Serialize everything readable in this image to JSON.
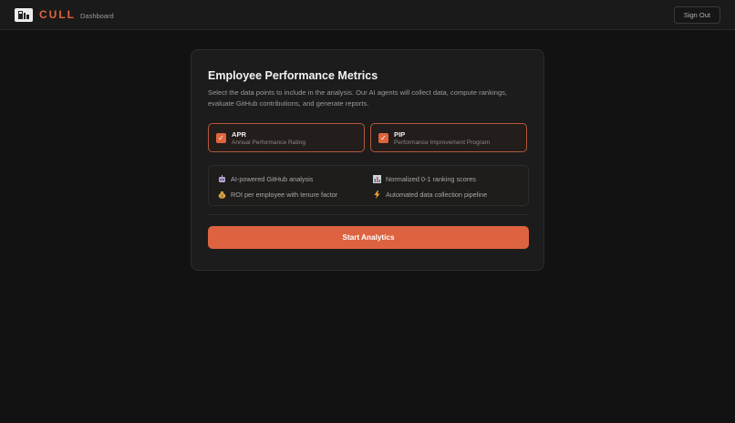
{
  "header": {
    "brand": "CULL",
    "subtitle": "Dashboard",
    "signout_label": "Sign Out"
  },
  "card": {
    "title": "Employee Performance Metrics",
    "description": "Select the data points to include in the analysis. Our AI agents will collect data, compute rankings, evaluate GitHub contributions, and generate reports.",
    "options": [
      {
        "title": "APR",
        "subtitle": "Annual Performance Rating",
        "checked": true
      },
      {
        "title": "PIP",
        "subtitle": "Performance Improvement Program",
        "checked": true
      }
    ],
    "features": [
      {
        "icon": "robot-icon",
        "label": "AI-powered GitHub analysis"
      },
      {
        "icon": "bar-chart-icon",
        "label": "Normalized 0-1 ranking scores"
      },
      {
        "icon": "money-bag-icon",
        "label": "ROI per employee with tenure factor"
      },
      {
        "icon": "lightning-icon",
        "label": "Automated data collection pipeline"
      }
    ],
    "start_label": "Start Analytics"
  },
  "colors": {
    "accent": "#dd6340",
    "background": "#121212",
    "card": "#1c1c1c"
  }
}
